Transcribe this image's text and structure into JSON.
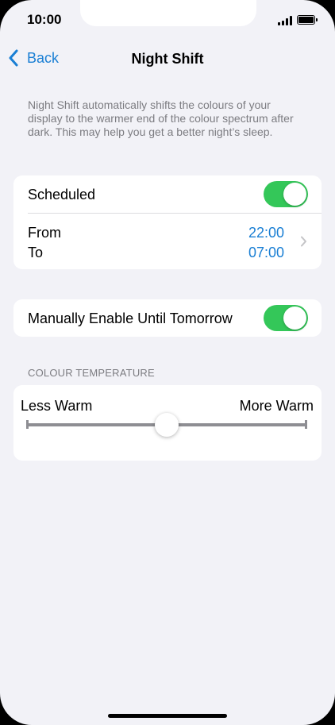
{
  "status_bar": {
    "time": "10:00",
    "icons": [
      "signal-icon",
      "battery-icon"
    ]
  },
  "nav": {
    "back_label": "Back",
    "title": "Night Shift"
  },
  "description": "Night Shift automatically shifts the colours of your display to the warmer end of the colour spectrum after dark. This may help you get a better night’s sleep.",
  "schedule": {
    "label": "Scheduled",
    "enabled": true,
    "from_label": "From",
    "to_label": "To",
    "from_value": "22:00",
    "to_value": "07:00"
  },
  "manual": {
    "label": "Manually Enable Until Tomorrow",
    "enabled": true
  },
  "temperature": {
    "header": "COLOUR TEMPERATURE",
    "min_label": "Less Warm",
    "max_label": "More Warm",
    "level": 0.5
  },
  "colors": {
    "accent": "#1a7fd4",
    "toggle_on": "#34c759",
    "background": "#f2f2f7"
  }
}
